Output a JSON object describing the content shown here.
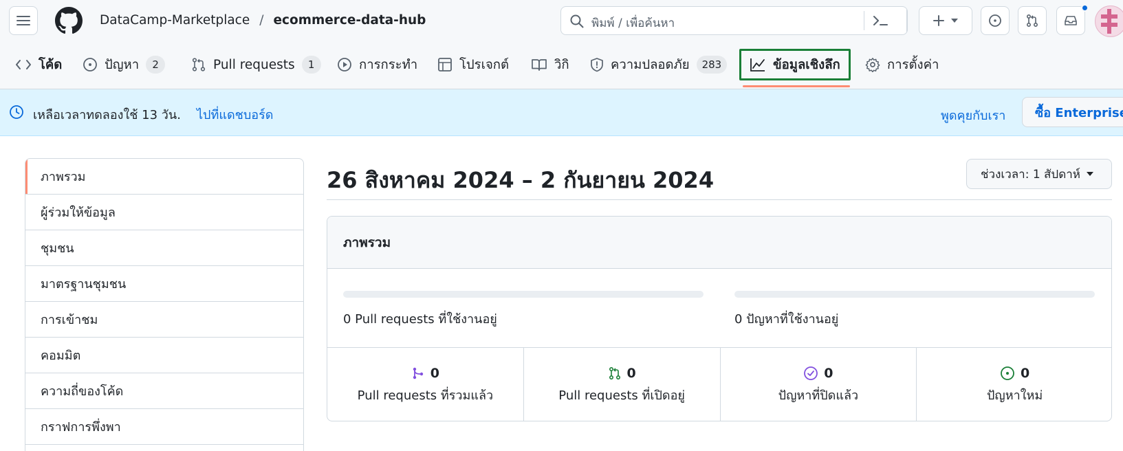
{
  "header": {
    "owner": "DataCamp-Marketplace",
    "separator": "/",
    "repo": "ecommerce-data-hub",
    "search_placeholder": "พิมพ์ / เพื่อค้นหา"
  },
  "tabs": [
    {
      "label": "โค้ด",
      "icon": "code-icon"
    },
    {
      "label": "ปัญหา",
      "icon": "issue-opened-icon",
      "count": "2"
    },
    {
      "label": "Pull requests",
      "icon": "git-pull-request-icon",
      "count": "1"
    },
    {
      "label": "การกระทำ",
      "icon": "play-icon"
    },
    {
      "label": "โปรเจกต์",
      "icon": "table-icon"
    },
    {
      "label": "วิกิ",
      "icon": "book-icon"
    },
    {
      "label": "ความปลอดภัย",
      "icon": "shield-icon",
      "count": "283"
    },
    {
      "label": "ข้อมูลเชิงลึก",
      "icon": "graph-icon",
      "selected": true
    },
    {
      "label": "การตั้งค่า",
      "icon": "gear-icon"
    }
  ],
  "banner": {
    "message": "เหลือเวลาทดลองใช้ 13 วัน.",
    "dashboard_link": "ไปที่แดชบอร์ด",
    "chat_link": "พูดคุยกับเรา",
    "buy_button": "ซื้อ Enterprise"
  },
  "sidebar": {
    "items": [
      {
        "label": "ภาพรวม",
        "active": true
      },
      {
        "label": "ผู้ร่วมให้ข้อมูล"
      },
      {
        "label": "ชุมชน"
      },
      {
        "label": "มาตรฐานชุมชน"
      },
      {
        "label": "การเข้าชม"
      },
      {
        "label": "คอมมิต"
      },
      {
        "label": "ความถี่ของโค้ด"
      },
      {
        "label": "กราฟการพึ่งพา"
      }
    ]
  },
  "main": {
    "period_title": "26 สิงหาคม 2024 – 2 กันยายน 2024",
    "period_button": "ช่วงเวลา: 1 สัปดาห์",
    "overview": {
      "title": "ภาพรวม",
      "active_prs": "0 Pull requests ที่ใช้งานอยู่",
      "active_prs_fraction": 0,
      "active_issues": "0 ปัญหาที่ใช้งานอยู่",
      "active_issues_fraction": 0,
      "stats": [
        {
          "count": "0",
          "label": "Pull requests ที่รวมแล้ว",
          "icon": "git-merge-icon",
          "color": "#8250df"
        },
        {
          "count": "0",
          "label": "Pull requests ที่เปิดอยู่",
          "icon": "git-pull-request-icon",
          "color": "#1a7f37"
        },
        {
          "count": "0",
          "label": "ปัญหาที่ปิดแล้ว",
          "icon": "issue-closed-icon",
          "color": "#8250df"
        },
        {
          "count": "0",
          "label": "ปัญหาใหม่",
          "icon": "issue-opened-icon",
          "color": "#1a7f37"
        }
      ]
    }
  },
  "colors": {
    "accent_link": "#0969da",
    "selected_tab_border": "#1a7f37",
    "tab_underline": "#fd8c73",
    "banner_bg": "#ddf4ff"
  }
}
